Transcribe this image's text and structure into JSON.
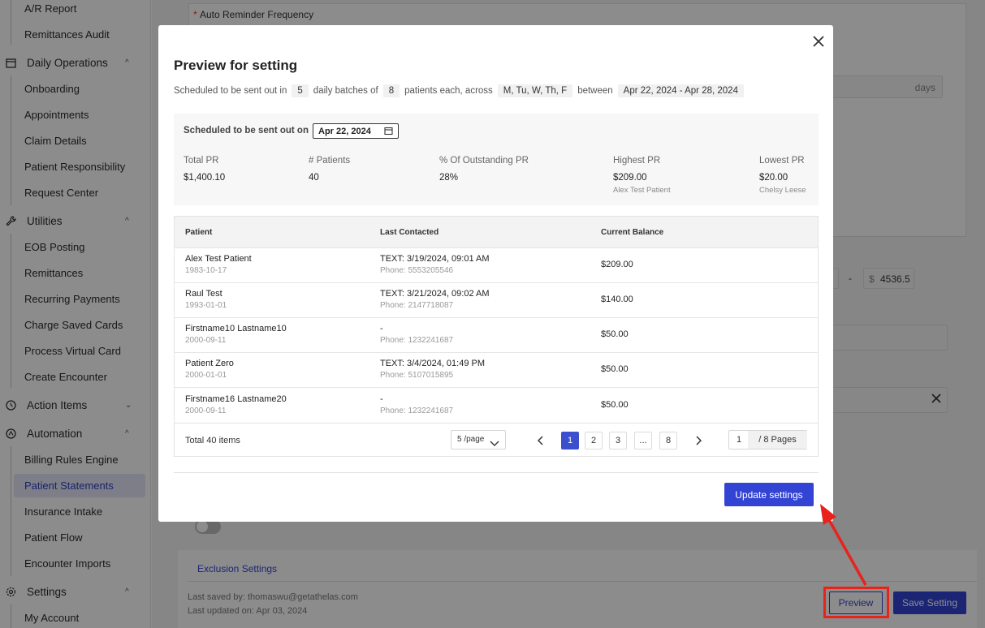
{
  "sidebar": {
    "items": [
      {
        "label": "A/R Report"
      },
      {
        "label": "Remittances Audit"
      },
      {
        "label": "Daily Operations"
      },
      {
        "label": "Onboarding"
      },
      {
        "label": "Appointments"
      },
      {
        "label": "Claim Details"
      },
      {
        "label": "Patient Responsibility"
      },
      {
        "label": "Request Center"
      },
      {
        "label": "Utilities"
      },
      {
        "label": "EOB Posting"
      },
      {
        "label": "Remittances"
      },
      {
        "label": "Recurring Payments"
      },
      {
        "label": "Charge Saved Cards"
      },
      {
        "label": "Process Virtual Card"
      },
      {
        "label": "Create Encounter"
      },
      {
        "label": "Action Items"
      },
      {
        "label": "Automation"
      },
      {
        "label": "Billing Rules Engine"
      },
      {
        "label": "Patient Statements"
      },
      {
        "label": "Insurance Intake"
      },
      {
        "label": "Patient Flow"
      },
      {
        "label": "Encounter Imports"
      },
      {
        "label": "Settings"
      },
      {
        "label": "My Account"
      }
    ]
  },
  "background": {
    "required_mark": "*",
    "reminder_label": "Auto Reminder Frequency",
    "days_suffix": "days",
    "range_separator": "-",
    "currency_symbol": "$",
    "max_amount": "4536.5",
    "exclusion_link": "Exclusion Settings",
    "last_saved": "Last saved by: thomaswu@getathelas.com",
    "last_updated": "Last updated on: Apr 03, 2024",
    "preview_button": "Preview",
    "save_button": "Save Setting"
  },
  "modal": {
    "title": "Preview for setting",
    "schedule": {
      "prefix": "Scheduled to be sent out in",
      "batches": "5",
      "batches_suffix": "daily batches of",
      "patients": "8",
      "patients_suffix": "patients each, across",
      "days": "M, Tu, W, Th, F",
      "between_label": "between",
      "date_range": "Apr 22, 2024 - Apr 28, 2024"
    },
    "summary": {
      "sent_label": "Scheduled to be sent out on",
      "date": "Apr 22, 2024",
      "stats": [
        {
          "label": "Total PR",
          "value": "$1,400.10",
          "sub": ""
        },
        {
          "label": "# Patients",
          "value": "40",
          "sub": ""
        },
        {
          "label": "% Of Outstanding PR",
          "value": "28%",
          "sub": ""
        },
        {
          "label": "Highest PR",
          "value": "$209.00",
          "sub": "Alex Test Patient"
        },
        {
          "label": "Lowest PR",
          "value": "$20.00",
          "sub": "Chelsy Leese"
        }
      ]
    },
    "table": {
      "columns": [
        "Patient",
        "Last Contacted",
        "Current Balance"
      ],
      "rows": [
        {
          "name": "Alex Test Patient",
          "dob": "1983-10-17",
          "contact": "TEXT: 3/19/2024, 09:01 AM",
          "phone": "Phone: 5553205546",
          "balance": "$209.00"
        },
        {
          "name": "Raul Test",
          "dob": "1993-01-01",
          "contact": "TEXT: 3/21/2024, 09:02 AM",
          "phone": "Phone: 2147718087",
          "balance": "$140.00"
        },
        {
          "name": "Firstname10 Lastname10",
          "dob": "2000-09-11",
          "contact": "-",
          "phone": "Phone: 1232241687",
          "balance": "$50.00"
        },
        {
          "name": "Patient Zero",
          "dob": "2000-01-01",
          "contact": "TEXT: 3/4/2024, 01:49 PM",
          "phone": "Phone: 5107015895",
          "balance": "$50.00"
        },
        {
          "name": "Firstname16 Lastname20",
          "dob": "2000-09-11",
          "contact": "-",
          "phone": "Phone: 1232241687",
          "balance": "$50.00"
        }
      ],
      "total": "Total 40 items",
      "page_size": "5 /page",
      "pages": [
        "1",
        "2",
        "3",
        "...",
        "8"
      ],
      "current_page": "1",
      "page_total": "/ 8 Pages"
    },
    "update_button": "Update settings"
  },
  "colors": {
    "primary": "#3344d4",
    "active_nav_bg": "#e3e6f7",
    "annotation": "#e8231c"
  }
}
